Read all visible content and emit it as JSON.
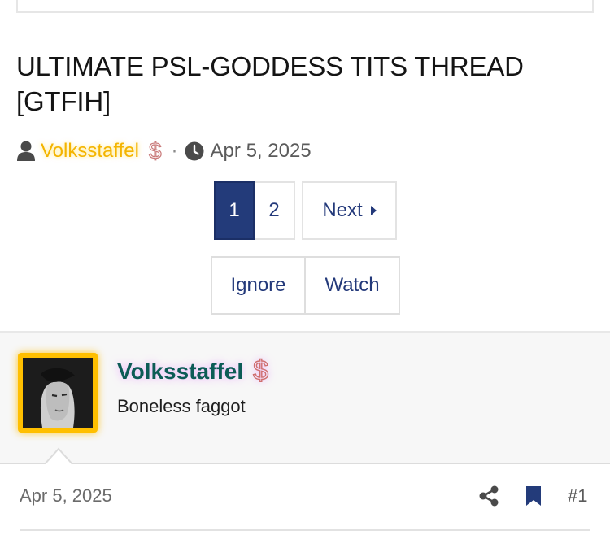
{
  "thread": {
    "title": "ULTIMATE PSL-GODDESS TITS THREAD [GTFIH]",
    "author": "Volksstaffel",
    "author_badge": "$",
    "separator": "·",
    "date": "Apr 5, 2025"
  },
  "pagination": {
    "pages": [
      "1",
      "2"
    ],
    "current": "1",
    "next_label": "Next"
  },
  "actions": {
    "ignore_label": "Ignore",
    "watch_label": "Watch"
  },
  "post": {
    "username": "Volksstaffel",
    "badge": "$",
    "user_title": "Boneless faggot",
    "date": "Apr 5, 2025",
    "number": "#1"
  },
  "colors": {
    "accent": "#233b7a",
    "author": "#f4b400",
    "username": "#0c5c56",
    "avatar_border": "#ffbf00"
  },
  "icons": {
    "author": "user-icon",
    "date": "clock-icon",
    "next": "caret-right-icon",
    "share": "share-icon",
    "bookmark": "bookmark-icon"
  }
}
